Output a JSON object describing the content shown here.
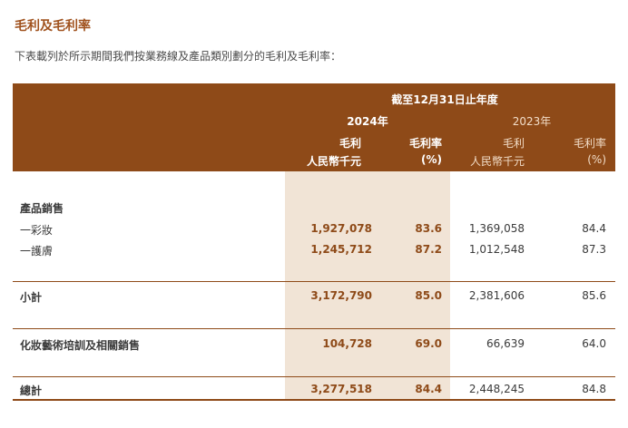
{
  "title": "毛利及毛利率",
  "subtitle": "下表載列於所示期間我們按業務線及產品類別劃分的毛利及毛利率：",
  "header": {
    "period": "截至12月31日止年度",
    "year_2024": "2024年",
    "year_2023": "2023年",
    "gp": "毛利",
    "gp_unit": "人民幣千元",
    "gpm": "毛利率",
    "gpm_unit": "(%)"
  },
  "rows": {
    "section_product_sales": "產品銷售",
    "makeup": {
      "label": "一彩妝",
      "gp_2024": "1,927,078",
      "gpm_2024": "83.6",
      "gp_2023": "1,369,058",
      "gpm_2023": "84.4"
    },
    "skincare": {
      "label": "一護膚",
      "gp_2024": "1,245,712",
      "gpm_2024": "87.2",
      "gp_2023": "1,012,548",
      "gpm_2023": "87.3"
    },
    "subtotal": {
      "label": "小計",
      "gp_2024": "3,172,790",
      "gpm_2024": "85.0",
      "gp_2023": "2,381,606",
      "gpm_2023": "85.6"
    },
    "training": {
      "label": "化妝藝術培訓及相關銷售",
      "gp_2024": "104,728",
      "gpm_2024": "69.0",
      "gp_2023": "66,639",
      "gpm_2023": "64.0"
    },
    "total": {
      "label": "總計",
      "gp_2024": "3,277,518",
      "gpm_2024": "84.4",
      "gp_2023": "2,448,245",
      "gpm_2023": "84.8"
    }
  },
  "colors": {
    "accent": "#8e4a18",
    "title": "#a0521e",
    "highlight": "#f1e4d6"
  }
}
